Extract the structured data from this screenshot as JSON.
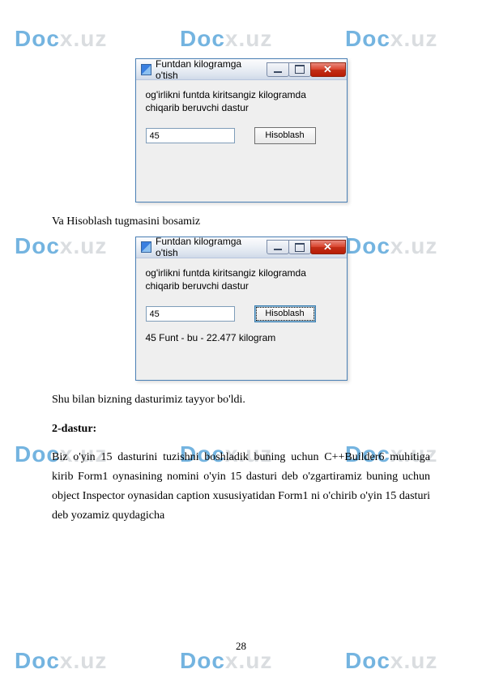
{
  "watermark": {
    "part1": "Doc",
    "part2": "x.uz"
  },
  "window1": {
    "title": "Funtdan kilogramga o'tish",
    "label": "og'irlikni funtda kiritsangiz kilogramda chiqarib beruvchi dastur",
    "input_value": "45",
    "button": "Hisoblash"
  },
  "window2": {
    "title": "Funtdan kilogramga o'tish",
    "label": "og'irlikni funtda kiritsangiz kilogramda chiqarib beruvchi dastur",
    "input_value": "45",
    "button": "Hisoblash",
    "result": "45 Funt - bu - 22.477 kilogram"
  },
  "text": {
    "p1": "Va Hisoblash tugmasini bosamiz",
    "p2": "Shu bilan bizning dasturimiz tayyor bo'ldi.",
    "h": "2-dastur:",
    "p3": "Biz o'yin 15 dasturini tuzishni boshladik buning uchun C++Builder6 muhitiga kirib Form1 oynasining nomini o'yin 15 dasturi deb o'zgartiramiz buning uchun object Inspector oynasidan caption xususiyatidan Form1 ni o'chirib o'yin 15 dasturi deb yozamiz quydagicha"
  },
  "page_number": "28"
}
